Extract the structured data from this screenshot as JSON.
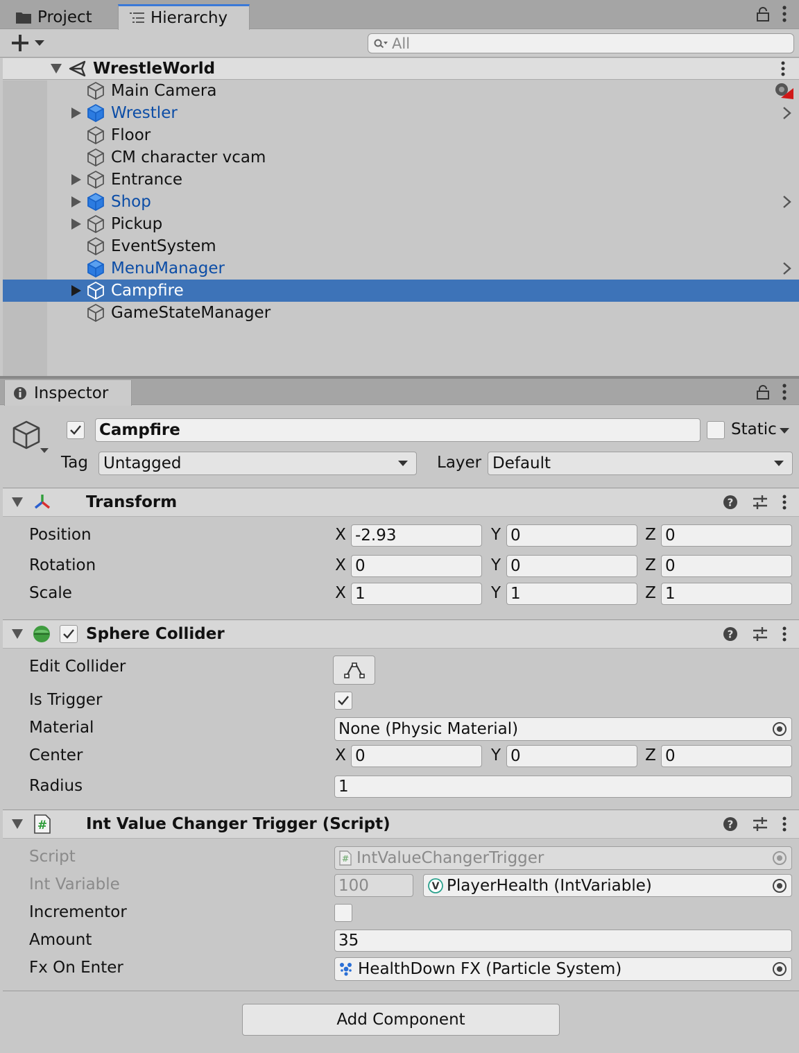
{
  "hierarchy_panel": {
    "tabs": [
      {
        "label": "Project",
        "icon": "folder-icon",
        "active": false
      },
      {
        "label": "Hierarchy",
        "icon": "list-icon",
        "active": true
      }
    ],
    "toolbar": {
      "create_label": "+",
      "search_placeholder": "All"
    },
    "scene": {
      "name": "WrestleWorld"
    },
    "items": [
      {
        "name": "Main Camera",
        "prefab": false,
        "expandable": false,
        "selected": false,
        "badge": "camera-gizmo-icon"
      },
      {
        "name": "Wrestler",
        "prefab": true,
        "expandable": true,
        "selected": false
      },
      {
        "name": "Floor",
        "prefab": false,
        "expandable": false,
        "selected": false
      },
      {
        "name": "CM character vcam",
        "prefab": false,
        "expandable": false,
        "selected": false
      },
      {
        "name": "Entrance",
        "prefab": false,
        "expandable": true,
        "selected": false
      },
      {
        "name": "Shop",
        "prefab": true,
        "expandable": true,
        "selected": false
      },
      {
        "name": "Pickup",
        "prefab": false,
        "expandable": true,
        "selected": false
      },
      {
        "name": "EventSystem",
        "prefab": false,
        "expandable": false,
        "selected": false
      },
      {
        "name": "MenuManager",
        "prefab": true,
        "expandable": false,
        "selected": false
      },
      {
        "name": "Campfire",
        "prefab": false,
        "expandable": true,
        "selected": true
      },
      {
        "name": "GameStateManager",
        "prefab": false,
        "expandable": false,
        "selected": false
      }
    ]
  },
  "inspector": {
    "tab_label": "Inspector",
    "object": {
      "active": true,
      "name": "Campfire",
      "static_label": "Static",
      "static_checked": false,
      "tag_label": "Tag",
      "tag_value": "Untagged",
      "layer_label": "Layer",
      "layer_value": "Default"
    },
    "transform": {
      "title": "Transform",
      "position": {
        "label": "Position",
        "x": "-2.93",
        "y": "0",
        "z": "0"
      },
      "rotation": {
        "label": "Rotation",
        "x": "0",
        "y": "0",
        "z": "0"
      },
      "scale": {
        "label": "Scale",
        "x": "1",
        "y": "1",
        "z": "1"
      }
    },
    "axes": {
      "x": "X",
      "y": "Y",
      "z": "Z"
    },
    "sphere_collider": {
      "title": "Sphere Collider",
      "enabled": true,
      "edit_collider_label": "Edit Collider",
      "is_trigger_label": "Is Trigger",
      "is_trigger": true,
      "material_label": "Material",
      "material_value": "None (Physic Material)",
      "center": {
        "label": "Center",
        "x": "0",
        "y": "0",
        "z": "0"
      },
      "radius_label": "Radius",
      "radius_value": "1"
    },
    "script_component": {
      "title": "Int Value Changer Trigger (Script)",
      "script_label": "Script",
      "script_value": "IntValueChangerTrigger",
      "int_variable_label": "Int Variable",
      "int_variable_number": "100",
      "int_variable_value": "PlayerHealth (IntVariable)",
      "incrementor_label": "Incrementor",
      "incrementor": false,
      "amount_label": "Amount",
      "amount_value": "35",
      "fx_label": "Fx On Enter",
      "fx_value": "HealthDown FX (Particle System)"
    },
    "add_component_label": "Add Component"
  },
  "colors": {
    "selection": "#3d73b8",
    "prefab_text": "#0c4da6",
    "tab_accent": "#3a79d8"
  }
}
